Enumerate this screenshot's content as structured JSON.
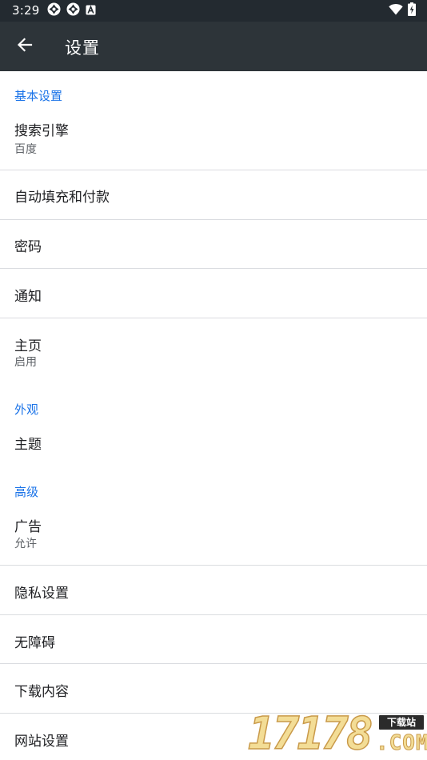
{
  "status_bar": {
    "time": "3:29",
    "left_icons": [
      "app-notification-icon",
      "app-notification-icon",
      "accessibility-a-icon"
    ],
    "right_icons": [
      "wifi-icon",
      "battery-charging-icon"
    ]
  },
  "app_bar": {
    "title": "设置",
    "back_icon": "arrow-back-icon"
  },
  "sections": {
    "basic": {
      "header": "基本设置",
      "search_engine": {
        "title": "搜索引擎",
        "subtitle": "百度"
      },
      "autofill": {
        "title": "自动填充和付款"
      },
      "passwords": {
        "title": "密码"
      },
      "notifications": {
        "title": "通知"
      },
      "homepage": {
        "title": "主页",
        "subtitle": "启用"
      }
    },
    "appearance": {
      "header": "外观",
      "theme": {
        "title": "主题"
      }
    },
    "advanced": {
      "header": "高级",
      "ads": {
        "title": "广告",
        "subtitle": "允许"
      },
      "privacy": {
        "title": "隐私设置"
      },
      "accessibility": {
        "title": "无障碍"
      },
      "downloads": {
        "title": "下载内容"
      },
      "site_settings": {
        "title": "网站设置"
      }
    }
  },
  "watermark": {
    "digits": "17178",
    "badge": "下载站",
    "suffix": ".COM"
  },
  "colors": {
    "status_bar": "#232a30",
    "app_bar": "#2d3439",
    "section_header": "#1a73e8",
    "divider": "#dadce0"
  }
}
